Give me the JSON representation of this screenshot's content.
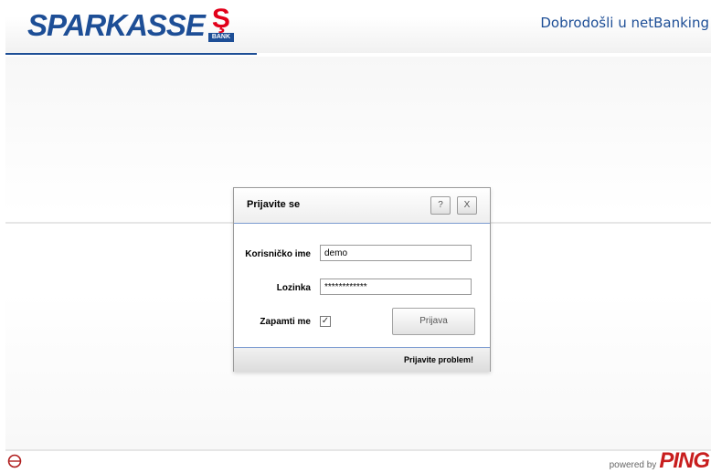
{
  "header": {
    "brand": "SPARKASSE",
    "brand_badge": "BANK",
    "welcome": "Dobrodošli u netBanking",
    "brand_color": "#1d4e96",
    "accent_color": "#e2001a"
  },
  "dialog": {
    "title": "Prijavite se",
    "help_label": "?",
    "close_label": "X",
    "username_label": "Korisničko ime",
    "username_value": "demo",
    "password_label": "Lozinka",
    "password_value": "************",
    "remember_label": "Zapamti me",
    "remember_checked": true,
    "login_button": "Prijava",
    "problem_link": "Prijavite problem!"
  },
  "footer": {
    "powered_by": "powered by",
    "vendor": "PING",
    "left_icon": "eye-logo-icon"
  }
}
